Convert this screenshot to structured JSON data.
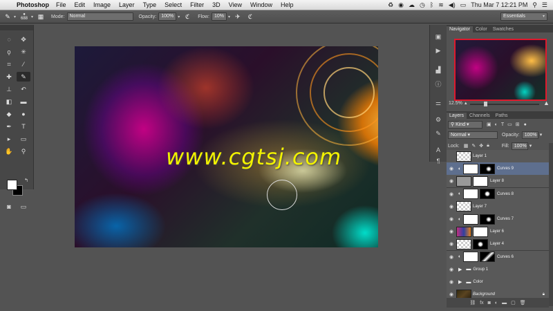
{
  "menubar": {
    "app": "Photoshop",
    "menus": [
      "File",
      "Edit",
      "Image",
      "Layer",
      "Type",
      "Select",
      "Filter",
      "3D",
      "View",
      "Window",
      "Help"
    ],
    "clock": "Thu Mar 7  12:21 PM"
  },
  "options": {
    "brush_size": "688",
    "mode_label": "Mode:",
    "mode_value": "Normal",
    "opacity_label": "Opacity:",
    "opacity_value": "100%",
    "flow_label": "Flow:",
    "flow_value": "10%",
    "workspace": "Essentials"
  },
  "canvas": {
    "watermark": "www.cgtsj.com"
  },
  "navigator": {
    "tabs": [
      "Navigator",
      "Color",
      "Swatches"
    ],
    "zoom": "12.5%",
    "zoom_level": 0.2
  },
  "layers": {
    "tabs": [
      "Layers",
      "Channels",
      "Paths"
    ],
    "kind_label": "Kind",
    "blend_mode": "Normal",
    "opacity_label": "Opacity:",
    "opacity_value": "100%",
    "lock_label": "Lock:",
    "fill_label": "Fill:",
    "fill_value": "100%",
    "items": [
      {
        "name": "Layer 1",
        "type": "pixel",
        "visible": false,
        "selected": false
      },
      {
        "name": "Curves 9",
        "type": "curves",
        "visible": true,
        "selected": true
      },
      {
        "name": "Layer 8",
        "type": "pixel",
        "visible": true,
        "selected": false
      },
      {
        "name": "Curves 8",
        "type": "curves",
        "visible": true,
        "selected": false
      },
      {
        "name": "Layer 7",
        "type": "pixel",
        "visible": true,
        "selected": false
      },
      {
        "name": "Curves 7",
        "type": "curves",
        "visible": true,
        "selected": false
      },
      {
        "name": "Layer 6",
        "type": "pixel",
        "visible": true,
        "selected": false
      },
      {
        "name": "Layer 4",
        "type": "pixel",
        "visible": true,
        "selected": false
      },
      {
        "name": "Curves 6",
        "type": "curves",
        "visible": true,
        "selected": false
      },
      {
        "name": "Group 1",
        "type": "group",
        "visible": true,
        "selected": false
      },
      {
        "name": "Color",
        "type": "group",
        "visible": true,
        "selected": false
      },
      {
        "name": "Background",
        "type": "background",
        "visible": true,
        "selected": false
      }
    ]
  }
}
